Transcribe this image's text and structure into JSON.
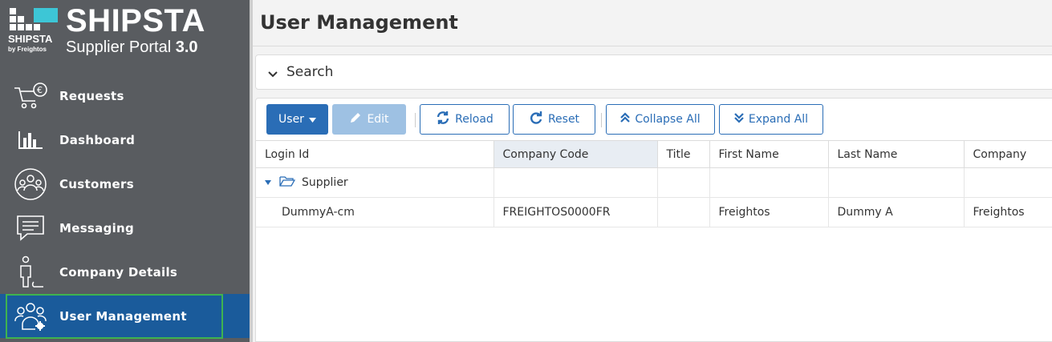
{
  "brand": {
    "name": "SHIPSTA",
    "mark_text": "SHIPSTA",
    "by_text": "by Freightos",
    "portal_text": "Supplier Portal",
    "version": "3.0"
  },
  "sidebar": {
    "items": [
      {
        "label": "Requests",
        "icon": "cart-euro-icon"
      },
      {
        "label": "Dashboard",
        "icon": "bar-chart-icon"
      },
      {
        "label": "Customers",
        "icon": "customers-icon"
      },
      {
        "label": "Messaging",
        "icon": "message-icon"
      },
      {
        "label": "Company Details",
        "icon": "company-person-icon"
      },
      {
        "label": "User Management",
        "icon": "users-gear-icon",
        "active": true
      }
    ],
    "active_color": "#1a5b9b",
    "highlight_color": "#3fb34f"
  },
  "main": {
    "title": "User Management",
    "search_label": "Search"
  },
  "toolbar": {
    "user_label": "User",
    "edit_label": "Edit",
    "reload_label": "Reload",
    "reset_label": "Reset",
    "collapse_label": "Collapse All",
    "expand_label": "Expand All"
  },
  "grid": {
    "columns": [
      "Login Id",
      "Company Code",
      "Title",
      "First Name",
      "Last Name",
      "Company"
    ],
    "group": {
      "label": "Supplier"
    },
    "rows": [
      {
        "login_id": "DummyA-cm",
        "company_code": "FREIGHTOS0000FR",
        "title": "",
        "first_name": "Freightos",
        "last_name": "Dummy A",
        "company": "Freightos"
      }
    ]
  },
  "colors": {
    "primary": "#2a6db6",
    "sidebar_bg": "#595c60"
  }
}
